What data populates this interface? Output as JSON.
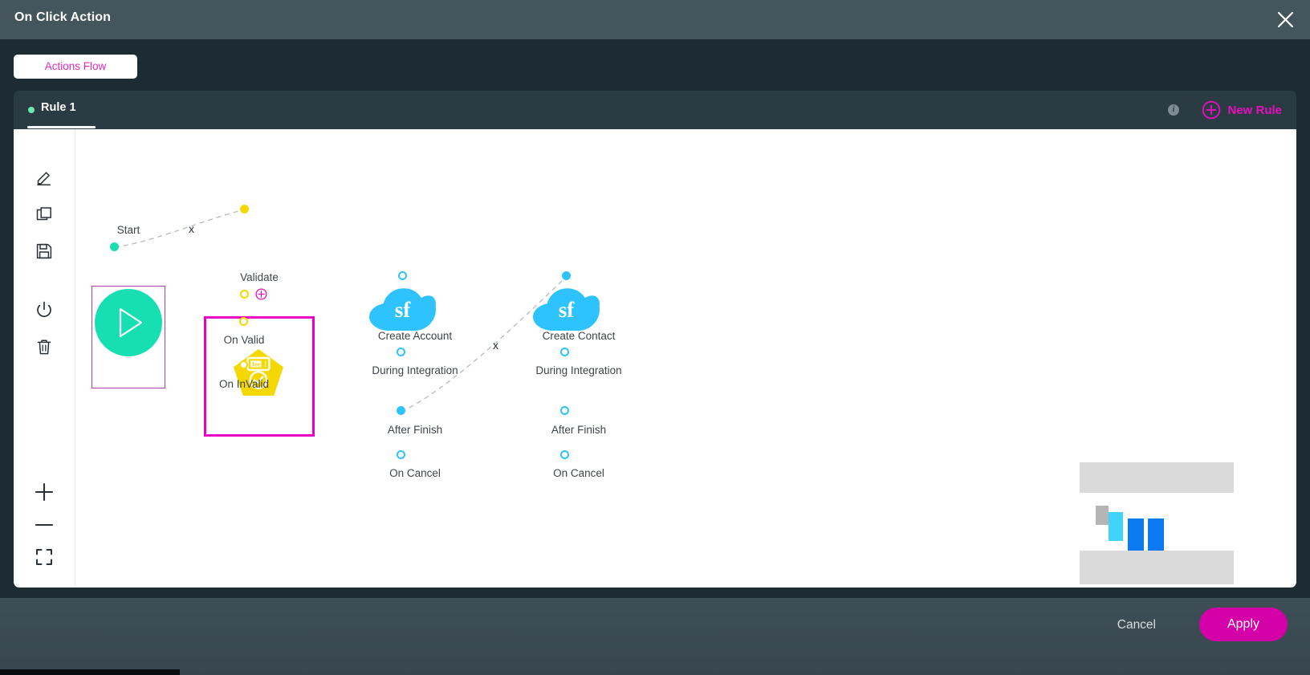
{
  "window": {
    "title": "On Click Action",
    "close_icon": "close-icon"
  },
  "toolbar": {
    "flow_tab_label": "Actions Flow"
  },
  "rules_bar": {
    "active_rule": "Rule 1",
    "info_icon": "info-icon",
    "info_glyph": "i",
    "new_rule_label": "New Rule",
    "new_rule_icon": "plus-circle-icon"
  },
  "canvas_tools": [
    {
      "name": "edit-tool",
      "icon": "pencil-icon"
    },
    {
      "name": "duplicate-tool",
      "icon": "copy-icon"
    },
    {
      "name": "save-tool",
      "icon": "floppy-disk-icon"
    },
    {
      "name": "power-tool",
      "icon": "power-icon"
    },
    {
      "name": "delete-tool",
      "icon": "trash-icon"
    },
    {
      "name": "zoom-in-tool",
      "icon": "plus-icon"
    },
    {
      "name": "zoom-out-tool",
      "icon": "minus-icon"
    },
    {
      "name": "fit-screen-tool",
      "icon": "fit-screen-icon"
    }
  ],
  "nodes": [
    {
      "id": "start",
      "label": "Start",
      "type": "start",
      "icon": "play-icon",
      "color": "#17dfb2",
      "selected_outline": "#b341a8",
      "ports": [
        {
          "label": "",
          "state": "filled",
          "color": "#1ddcb0"
        }
      ]
    },
    {
      "id": "validate",
      "label": "Validate",
      "type": "validate",
      "icon": "id-badge-check-icon",
      "badge_text": "Joe",
      "color": "#f5d800",
      "selected_outline": "#ea00c3",
      "ports": [
        {
          "label": "On Valid",
          "state": "hollow",
          "color": "#f5d800"
        },
        {
          "label": "On InValid",
          "state": "hollow",
          "color": "#f5d800"
        }
      ],
      "footer_icons": [
        "yellow-ring-icon",
        "add-circle-icon"
      ]
    },
    {
      "id": "create-account",
      "label": "Create Account",
      "type": "salesforce",
      "icon": "salesforce-cloud-icon",
      "icon_text": "sf",
      "color": "#2ec3ff",
      "ports": [
        {
          "label": "During Integration",
          "state": "hollow",
          "color": "#2ec3ff"
        },
        {
          "label": "After Finish",
          "state": "filled",
          "color": "#2ec3ff"
        },
        {
          "label": "On Cancel",
          "state": "hollow",
          "color": "#2ec3ff"
        }
      ]
    },
    {
      "id": "create-contact",
      "label": "Create Contact",
      "type": "salesforce",
      "icon": "salesforce-cloud-icon",
      "icon_text": "sf",
      "color": "#2ec3ff",
      "ports": [
        {
          "label": "During Integration",
          "state": "hollow",
          "color": "#2ec3ff"
        },
        {
          "label": "After Finish",
          "state": "hollow",
          "color": "#2ec3ff"
        },
        {
          "label": "On Cancel",
          "state": "hollow",
          "color": "#2ec3ff"
        }
      ]
    }
  ],
  "edges": [
    {
      "from": "start",
      "to": "validate",
      "delete_marker": "x"
    },
    {
      "from": "create-account",
      "to": "create-contact",
      "delete_marker": "x"
    }
  ],
  "minimap": {
    "name": "canvas-minimap",
    "nodes": [
      {
        "color": "#b5b5b5"
      },
      {
        "color": "#41d4fb"
      },
      {
        "color": "#0b79ef"
      },
      {
        "color": "#0b79ef"
      }
    ]
  },
  "footer": {
    "cancel_label": "Cancel",
    "apply_label": "Apply",
    "apply_color": "#d400a8"
  }
}
